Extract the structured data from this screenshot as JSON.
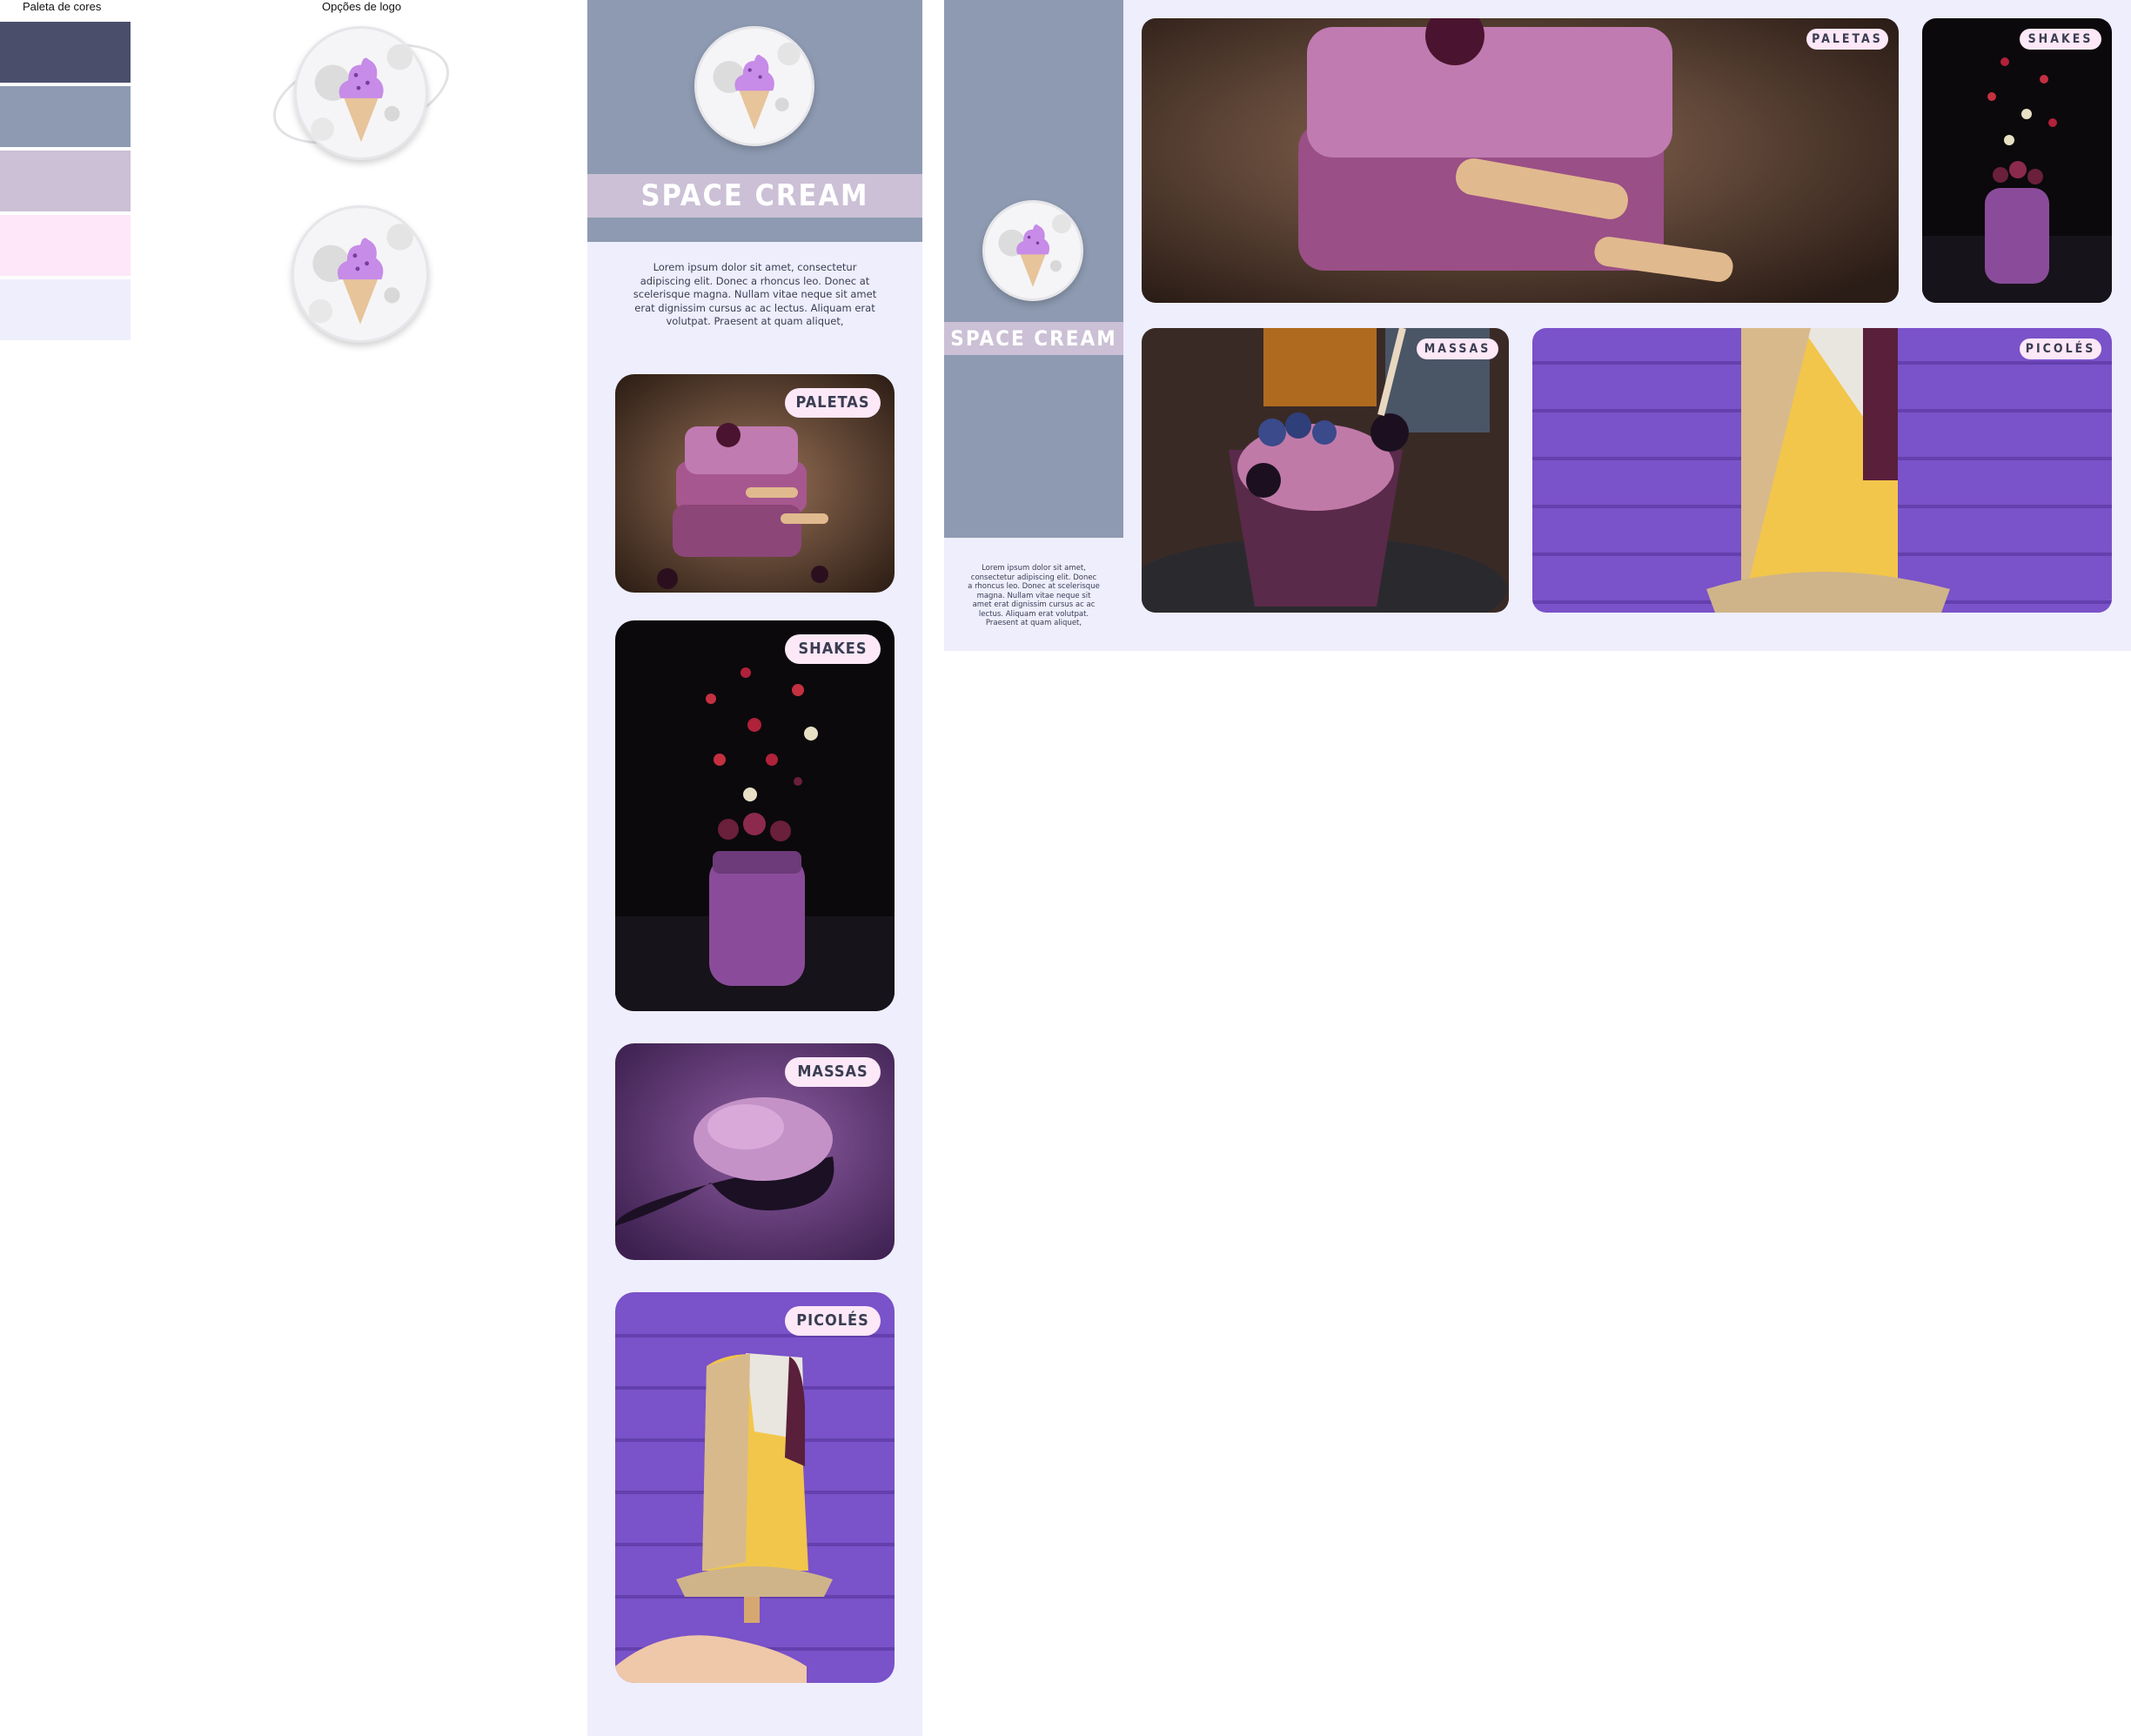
{
  "palette": {
    "title": "Paleta de cores",
    "colors": [
      "#4a4e6b",
      "#8d9ab1",
      "#cbc0d5",
      "#fde7f8",
      "#eeeefd"
    ]
  },
  "logos": {
    "title": "Opções de logo"
  },
  "brand": {
    "name": "SPACE CREAM"
  },
  "lorem": "Lorem ipsum dolor sit amet, consectetur adipiscing elit. Donec a rhoncus leo. Donec at scelerisque magna. Nullam vitae neque sit amet erat dignissim cursus ac ac lectus. Aliquam erat volutpat. Praesent at quam aliquet,",
  "categories": {
    "paletas": "PALETAS",
    "shakes": "SHAKES",
    "massas": "MASSAS",
    "picoles": "PICOLÉS"
  },
  "colors": {
    "page_bg": "#eeeefd",
    "header_bg": "#8d9ab1",
    "banner_bg": "#cbc0d5",
    "badge_bg": "#fde7f8",
    "ink": "#3a3d52"
  }
}
